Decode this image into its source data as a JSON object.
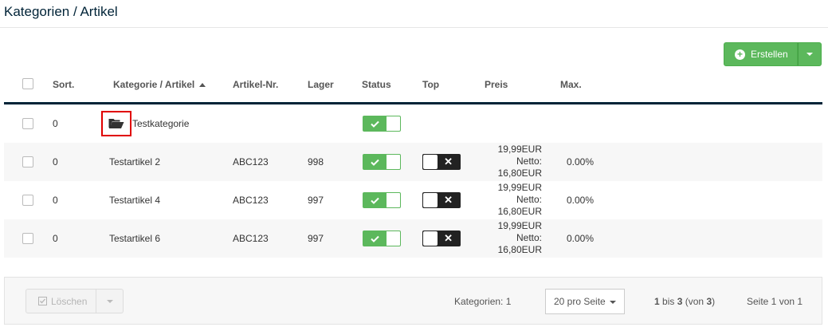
{
  "page": {
    "title": "Kategorien / Artikel"
  },
  "toolbar": {
    "create_label": "Erstellen"
  },
  "table": {
    "headers": {
      "sort": "Sort.",
      "category_article": "Kategorie / Artikel",
      "article_no": "Artikel-Nr.",
      "stock": "Lager",
      "status": "Status",
      "top": "Top",
      "price": "Preis",
      "max": "Max."
    },
    "category_row": {
      "sort": "0",
      "name": "Testkategorie",
      "status": true
    },
    "rows": [
      {
        "sort": "0",
        "name": "Testartikel 2",
        "article_no": "ABC123",
        "stock": "998",
        "status": true,
        "top": false,
        "price_gross": "19,99EUR",
        "price_net_label": "Netto:",
        "price_net": "16,80EUR",
        "max": "0.00%"
      },
      {
        "sort": "0",
        "name": "Testartikel 4",
        "article_no": "ABC123",
        "stock": "997",
        "status": true,
        "top": false,
        "price_gross": "19,99EUR",
        "price_net_label": "Netto:",
        "price_net": "16,80EUR",
        "max": "0.00%"
      },
      {
        "sort": "0",
        "name": "Testartikel 6",
        "article_no": "ABC123",
        "stock": "997",
        "status": true,
        "top": false,
        "price_gross": "19,99EUR",
        "price_net_label": "Netto:",
        "price_net": "16,80EUR",
        "max": "0.00%"
      }
    ]
  },
  "footer": {
    "delete_label": "Löschen",
    "categories_count": "Kategorien: 1",
    "per_page": "20 pro Seite",
    "range_from": "1",
    "range_bis": "bis",
    "range_to": "3",
    "range_von": "(von",
    "range_total": "3",
    "range_close": ")",
    "page_info": "Seite 1 von 1"
  },
  "colors": {
    "primary_dark": "#002337",
    "success": "#5cb85c",
    "highlight_box": "#e00000"
  },
  "icons": {
    "create": "plus-circle-icon",
    "category": "folder-open-icon",
    "status_on": "check-icon",
    "top_off": "x-icon",
    "delete": "checkbox-check-icon"
  }
}
